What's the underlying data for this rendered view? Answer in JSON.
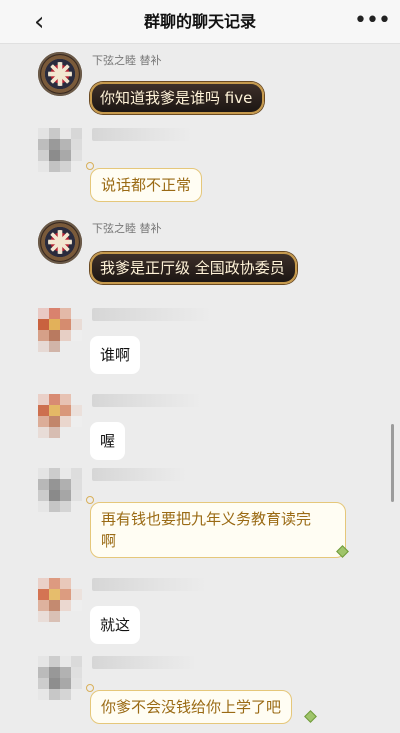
{
  "header": {
    "title": "群聊的聊天记录",
    "back_icon": "chevron-left-icon",
    "more_icon": "more-dots-icon",
    "more_glyph": "•••"
  },
  "messages": [
    {
      "sender": "下弦之睦 替补",
      "text": "你知道我爹是谁吗 five"
    },
    {
      "sender": "",
      "text": "说话都不正常"
    },
    {
      "sender": "下弦之睦 替补",
      "text": "我爹是正厅级 全国政协委员"
    },
    {
      "sender": "",
      "text": "谁啊"
    },
    {
      "sender": "",
      "text": "喔"
    },
    {
      "sender": "",
      "text": "再有钱也要把九年义务教育读完\n啊"
    },
    {
      "sender": "",
      "text": "就这"
    },
    {
      "sender": "",
      "text": "你爹不会没钱给你上学了吧"
    }
  ]
}
